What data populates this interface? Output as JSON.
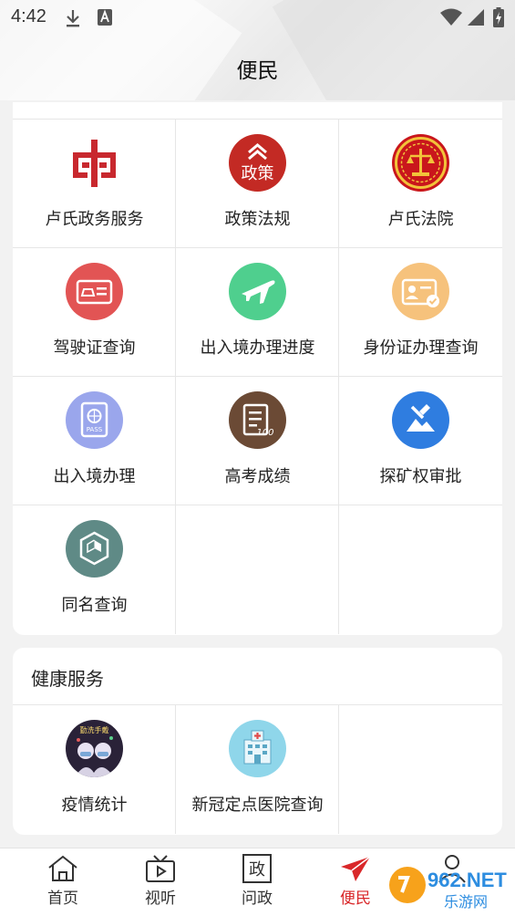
{
  "status_bar": {
    "time": "4:42"
  },
  "header": {
    "title": "便民"
  },
  "gov_services": {
    "items": [
      {
        "label": "卢氏政务服务",
        "icon": "gov-services-logo-icon"
      },
      {
        "label": "政策法规",
        "icon": "policy-icon"
      },
      {
        "label": "卢氏法院",
        "icon": "court-emblem-icon"
      },
      {
        "label": "驾驶证查询",
        "icon": "driver-license-icon"
      },
      {
        "label": "出入境办理进度",
        "icon": "airplane-icon"
      },
      {
        "label": "身份证办理查询",
        "icon": "id-card-icon"
      },
      {
        "label": "出入境办理",
        "icon": "passport-icon"
      },
      {
        "label": "高考成绩",
        "icon": "exam-score-icon"
      },
      {
        "label": "探矿权审批",
        "icon": "mining-icon"
      },
      {
        "label": "同名查询",
        "icon": "same-name-icon"
      }
    ],
    "icon_texts": {
      "policy": "政策",
      "passport": "PASS",
      "score": "100"
    }
  },
  "health": {
    "title": "健康服务",
    "items": [
      {
        "label": "疫情统计",
        "icon": "epidemic-stats-icon",
        "badge_text": "勤洗手戴"
      },
      {
        "label": "新冠定点医院查询",
        "icon": "hospital-icon"
      }
    ]
  },
  "bottom_nav": {
    "items": [
      {
        "label": "首页",
        "icon": "home-icon",
        "active": false
      },
      {
        "label": "视听",
        "icon": "tv-icon",
        "active": false
      },
      {
        "label": "问政",
        "icon": "gov-question-icon",
        "glyph": "政",
        "active": false
      },
      {
        "label": "便民",
        "icon": "paper-plane-icon",
        "active": true
      },
      {
        "label": "",
        "icon": "profile-icon",
        "active": false
      }
    ]
  },
  "watermark": {
    "brand": "962.NET",
    "sub": "乐游网"
  },
  "colors": {
    "accent": "#d9282a",
    "red": "#e25454",
    "green": "#4fcf8e",
    "orange": "#f6c27c",
    "purple": "#9aa6ec",
    "brown": "#6b4a35",
    "blue": "#2f7de0",
    "teal": "#5f8a86",
    "light_blue": "#8fd6ea"
  }
}
